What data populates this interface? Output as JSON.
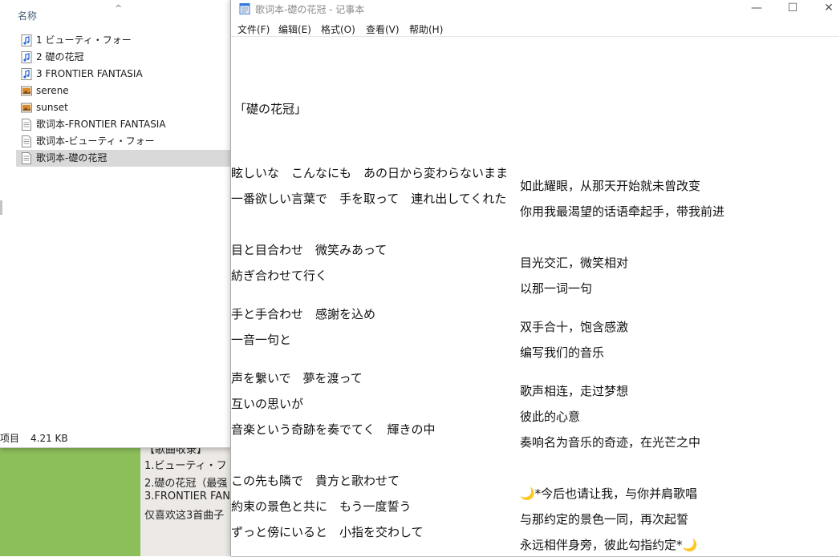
{
  "background": {
    "doc_lines": [
      "【歌曲收录】",
      "1.ビューティ・フ",
      "2.礎の花冠（最强",
      "3.FRONTIER FAN",
      "仅喜欢这3首曲子"
    ]
  },
  "explorer": {
    "column_header": "名称",
    "sort_indicator": "^",
    "files": [
      {
        "name": "1 ビューティ・フォー",
        "icon": "audio-file-icon",
        "selected": false
      },
      {
        "name": "2 礎の花冠",
        "icon": "audio-file-icon",
        "selected": false
      },
      {
        "name": "3 FRONTIER FANTASIA",
        "icon": "audio-file-icon",
        "selected": false
      },
      {
        "name": "serene",
        "icon": "image-file-icon",
        "selected": false
      },
      {
        "name": "sunset",
        "icon": "image-file-icon",
        "selected": false
      },
      {
        "name": "歌词本-FRONTIER FANTASIA",
        "icon": "text-file-icon",
        "selected": false
      },
      {
        "name": "歌词本-ビューティ・フォー",
        "icon": "text-file-icon",
        "selected": false
      },
      {
        "name": "歌词本-礎の花冠",
        "icon": "text-file-icon",
        "selected": true
      }
    ],
    "status": {
      "selection": "项目",
      "size": "4.21 KB"
    }
  },
  "notepad": {
    "title": "歌词本-礎の花冠 - 记事本",
    "controls": {
      "minimize": "—",
      "maximize": "☐",
      "close": "✕"
    },
    "menu": [
      "文件(F)",
      "编辑(E)",
      "格式(O)",
      "查看(V)",
      "帮助(H)"
    ],
    "song_title": "「礎の花冠」",
    "jp_lines": [
      "眩しいな　こんなにも　あの日から変わらないまま",
      "一番欲しい言葉で　手を取って　連れ出してくれた",
      "目と目合わせ　微笑みあって",
      "紡ぎ合わせて行く",
      "手と手合わせ　感謝を込め",
      "一音一句と",
      "声を繋いで　夢を渡って",
      "互いの思いが",
      "音楽という奇跡を奏でてく　輝きの中",
      "この先も隣で　貴方と歌わせて",
      "約束の景色と共に　もう一度誓う",
      "ずっと傍にいると　小指を交わして"
    ],
    "cn_lines": [
      "如此耀眼，从那天开始就未曾改变",
      "你用我最渴望的话语牵起手，带我前进",
      "目光交汇，微笑相对",
      "以那一词一句",
      "双手合十，饱含感激",
      "编写我们的音乐",
      "歌声相连，走过梦想",
      "彼此的心意",
      "奏响名为音乐的奇迹，在光芒之中",
      "🌙*今后也请让我，与你并肩歌唱",
      "与那约定的景色一同，再次起誓",
      "永远相伴身旁，彼此勾指约定*🌙"
    ]
  }
}
